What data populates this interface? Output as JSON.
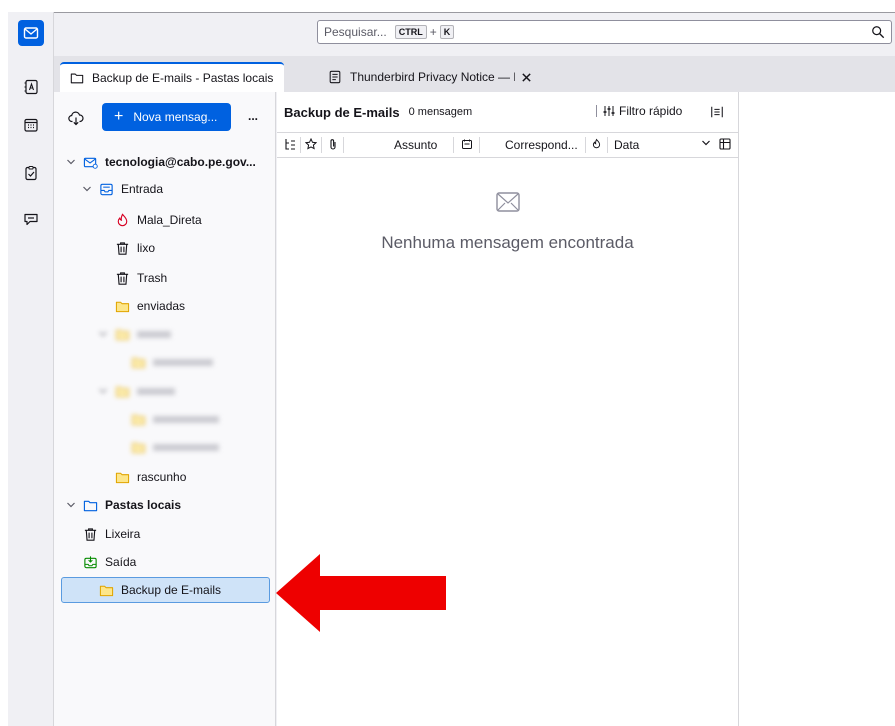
{
  "search": {
    "placeholder": "Pesquisar...",
    "key1": "CTRL",
    "plus": "+",
    "key2": "K"
  },
  "tabs": [
    {
      "label": "Backup de E-mails - Pastas locais"
    },
    {
      "label": "Thunderbird Privacy Notice — Mozi"
    }
  ],
  "folder_pane": {
    "new_message": "Nova mensag...",
    "more": "...",
    "folders": {
      "account": "tecnologia@cabo.pe.gov...",
      "inbox": "Entrada",
      "mala_direta": "Mala_Direta",
      "lixo": "lixo",
      "trash": "Trash",
      "enviadas": "enviadas",
      "rascunho": "rascunho",
      "local_folders": "Pastas locais",
      "lixeira": "Lixeira",
      "saida": "Saída",
      "backup": "Backup de E-mails"
    }
  },
  "message_list": {
    "title": "Backup de E-mails",
    "count": "0 mensagem",
    "quick_filter": "Filtro rápido",
    "columns": {
      "subject": "Assunto",
      "correspondents": "Correspond...",
      "date": "Data"
    },
    "empty_text": "Nenhuma mensagem encontrada"
  },
  "colors": {
    "accent": "#0061e0",
    "arrow": "#ee0000",
    "selected_bg": "#cfe3f8"
  }
}
